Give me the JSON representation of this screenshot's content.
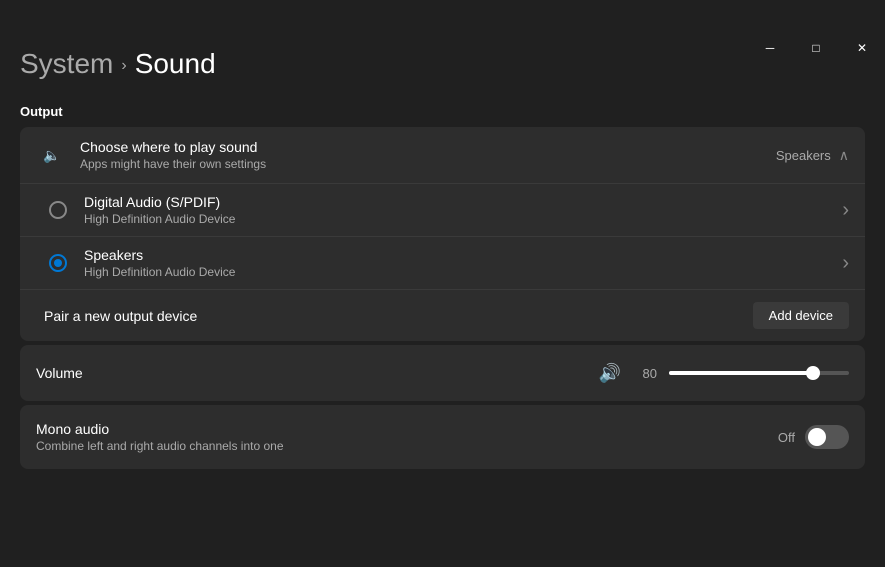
{
  "window": {
    "title": "Sound",
    "minimize_label": "─",
    "maximize_label": "□",
    "close_label": "✕"
  },
  "breadcrumb": {
    "system_label": "System",
    "chevron": "›",
    "current": "Sound"
  },
  "output": {
    "section_label": "Output",
    "choose_row": {
      "icon": "🔈",
      "title": "Choose where to play sound",
      "subtitle": "Apps might have their own settings",
      "selected_device": "Speakers"
    },
    "devices": [
      {
        "name": "Digital Audio (S/PDIF)",
        "subname": "High Definition Audio Device",
        "selected": false
      },
      {
        "name": "Speakers",
        "subname": "High Definition Audio Device",
        "selected": true
      }
    ],
    "pair_label": "Pair a new output device",
    "add_device_label": "Add device"
  },
  "volume": {
    "label": "Volume",
    "icon": "🔊",
    "value": 80,
    "value_display": "80"
  },
  "mono_audio": {
    "title": "Mono audio",
    "subtitle": "Combine left and right audio channels into one",
    "toggle_label": "Off",
    "toggle_state": false
  }
}
